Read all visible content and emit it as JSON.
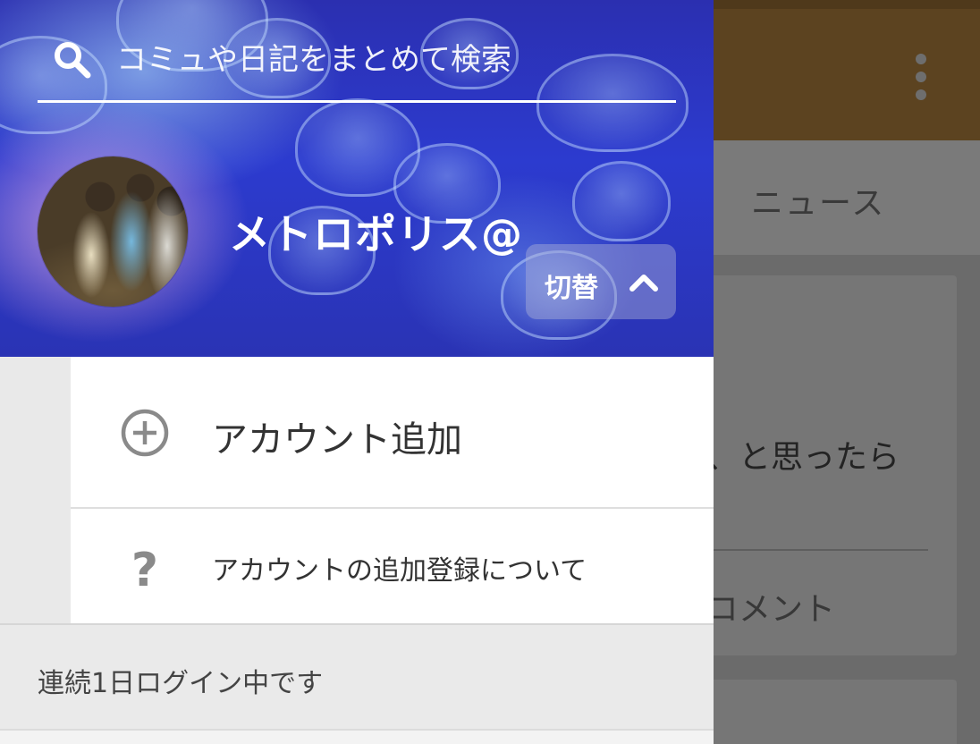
{
  "background": {
    "tab_news": "ニュース",
    "card_text": "、と思ったら",
    "card_comment": "コメント"
  },
  "drawer": {
    "search": {
      "placeholder": "コミュや日記をまとめて検索",
      "value": ""
    },
    "user": {
      "name": "メトロポリス@"
    },
    "switch_button": {
      "label": "切替",
      "icon": "chevron-up-icon"
    },
    "menu": {
      "items": [
        {
          "label": "アカウント追加",
          "icon": "add-circle-icon"
        },
        {
          "label": "アカウントの追加登録について",
          "icon": "help-icon",
          "glyph": "?"
        }
      ]
    },
    "login_status": "連続1日ログイン中です"
  },
  "colors": {
    "appbar": "#5c4320",
    "header_blue": "#2c3bcf",
    "menu_bg": "#ffffff",
    "text_dark": "#333333",
    "icon_gray": "#8a8a8a"
  }
}
